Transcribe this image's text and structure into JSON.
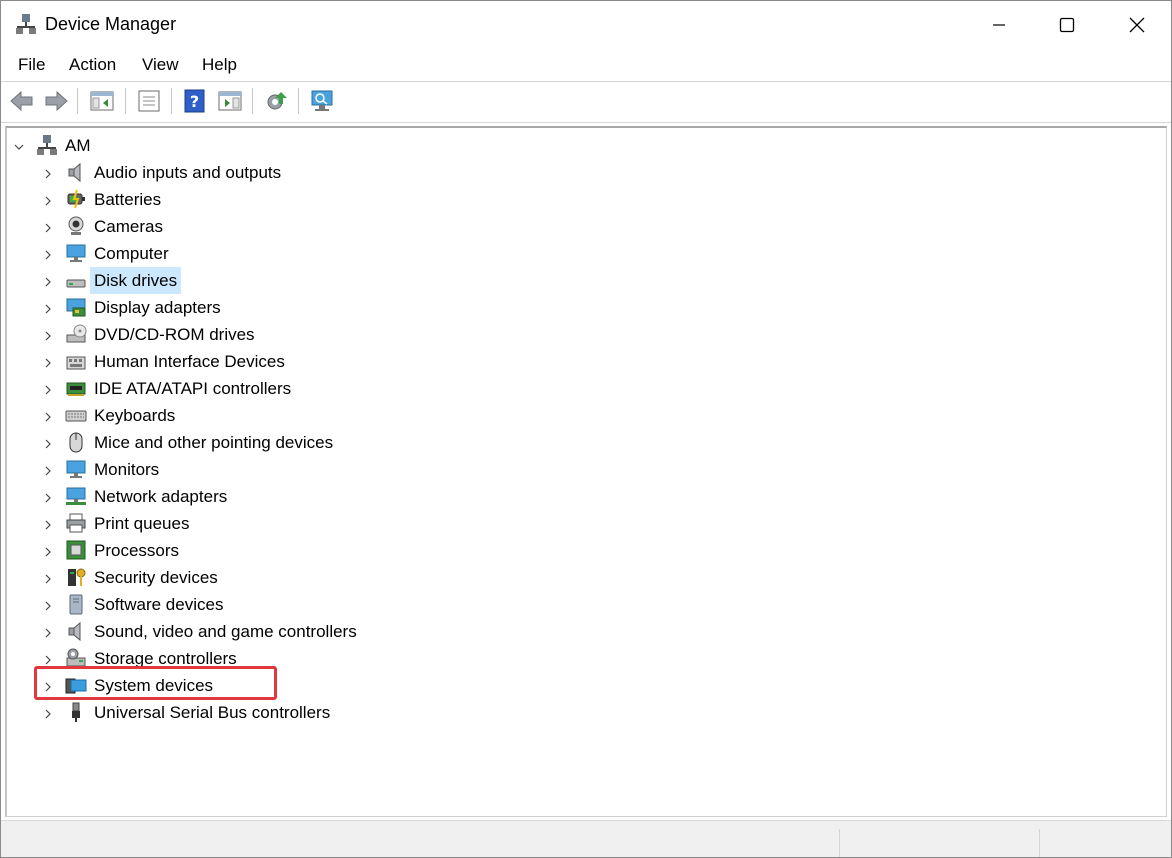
{
  "window": {
    "title": "Device Manager"
  },
  "menu": {
    "file": "File",
    "action": "Action",
    "view": "View",
    "help": "Help"
  },
  "tree": {
    "root": "AM",
    "items": [
      {
        "label": "Audio inputs and outputs",
        "icon": "speaker-icon"
      },
      {
        "label": "Batteries",
        "icon": "battery-icon"
      },
      {
        "label": "Cameras",
        "icon": "camera-icon"
      },
      {
        "label": "Computer",
        "icon": "monitor-icon"
      },
      {
        "label": "Disk drives",
        "icon": "disk-drive-icon"
      },
      {
        "label": "Display adapters",
        "icon": "display-adapter-icon"
      },
      {
        "label": "DVD/CD-ROM drives",
        "icon": "dvd-drive-icon"
      },
      {
        "label": "Human Interface Devices",
        "icon": "hid-icon"
      },
      {
        "label": "IDE ATA/ATAPI controllers",
        "icon": "ide-controller-icon"
      },
      {
        "label": "Keyboards",
        "icon": "keyboard-icon"
      },
      {
        "label": "Mice and other pointing devices",
        "icon": "mouse-icon"
      },
      {
        "label": "Monitors",
        "icon": "monitor-icon"
      },
      {
        "label": "Network adapters",
        "icon": "network-adapter-icon"
      },
      {
        "label": "Print queues",
        "icon": "printer-icon"
      },
      {
        "label": "Processors",
        "icon": "processor-icon"
      },
      {
        "label": "Security devices",
        "icon": "security-device-icon"
      },
      {
        "label": "Software devices",
        "icon": "software-device-icon"
      },
      {
        "label": "Sound, video and game controllers",
        "icon": "speaker-icon"
      },
      {
        "label": "Storage controllers",
        "icon": "storage-controller-icon"
      },
      {
        "label": "System devices",
        "icon": "system-devices-icon"
      },
      {
        "label": "Universal Serial Bus controllers",
        "icon": "usb-icon"
      }
    ],
    "selected": "Disk drives",
    "highlighted": "System devices"
  },
  "colors": {
    "selection": "#cce8ff",
    "highlight_box": "#e0383e"
  }
}
